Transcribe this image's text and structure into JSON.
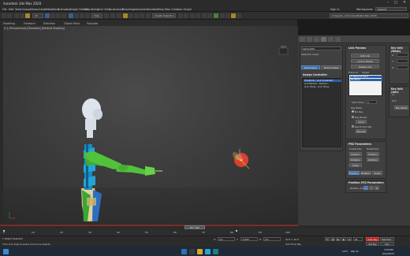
{
  "window": {
    "title": "Autodesk 3ds Max 2020",
    "workspace_label": "Workspaces:",
    "workspace_value": "Default",
    "signin": "Sign In"
  },
  "menu": [
    "File",
    "Edit",
    "Tools",
    "Group",
    "Views",
    "Create",
    "Modifiers",
    "Animation",
    "Graph Editors",
    "Rendering",
    "Civil View",
    "Customize",
    "Scripting",
    "Interactive",
    "Content",
    "Help",
    "Max Creation Graph"
  ],
  "toolbar": {
    "view_select": "View",
    "selection_set": "Create Selection Set",
    "path_field": "C:\\Users\\...\\Documents\\3ds Max 2020"
  },
  "ribbon": [
    "Modeling",
    "Freeform",
    "Selection",
    "Object Paint",
    "Populate"
  ],
  "viewport": {
    "label": "[+] [Perspective] [Standard] [Default Shading]"
  },
  "command_panel": {
    "object_name": "Sphere001",
    "selection_level_label": "Selection Level:",
    "tab_parameters": "Parameters",
    "tab_motion_paths": "Motion Paths",
    "assign_controller_title": "Assign Controller",
    "controller_list": [
      "Transform : Link Constraint",
      "Link Params : Position...",
      "Link Times : Link Times"
    ],
    "link_params_title": "Link Params",
    "add_link": "Add Link",
    "link_to_world": "Link to World",
    "delete_link": "Delete Link",
    "frame_col": "Frame #",
    "target_col": "Target",
    "link_list": [
      "0  Object-R Hand",
      "82  World"
    ],
    "start_time_label": "Start Time:",
    "start_time_value": "0",
    "key_mode_label": "Key Mode",
    "no_key": "No Key",
    "key_nodes": "Key Nodes",
    "key_entire_hierarchy": "Key Entire Hier.",
    "child": "Child",
    "parents": "Parents",
    "pos_params_title": "PRS Parameters",
    "create_key": "Create Key",
    "delete_key": "Delete Key",
    "position": "Position",
    "rotation": "Rotation",
    "scale": "Scale",
    "pos_btn": "Position",
    "rot_btn": "Rotation",
    "scale_btn": "Scale",
    "xyz_title": "Position XYZ Parameters",
    "position_axis": "Position Axis",
    "axis_x": "X",
    "axis_y": "Y",
    "axis_z": "Z",
    "key_info_basic": "Key Info (Basic)",
    "key_info_adv": "Key Info (Adv)",
    "side_x": "X:",
    "side_y": "Y:",
    "side_z": "Z:",
    "in_label": "In:",
    "out_label": "Out:",
    "normalize": "Normalize"
  },
  "timeline": {
    "slider_label": "82 / 100",
    "ticks": [
      "0",
      "10",
      "20",
      "30",
      "40",
      "50",
      "60",
      "70",
      "80",
      "90",
      "100"
    ]
  },
  "status": {
    "selected": "1 Object Selected",
    "hint": "Click and drag to select and move objects",
    "x_label": "X:",
    "x_value": "0.0",
    "y_label": "Y:",
    "y_value": "-0.461",
    "z_label": "Z:",
    "z_value": "0.0",
    "grid": "Grid = 10.0",
    "add_time_tag": "Add Time Tag",
    "auto_key": "Auto Key",
    "selected_dd": "Selected",
    "set_key": "Set Key",
    "key_filters": "Key Filters...",
    "frame": "82"
  },
  "taskbar": {
    "weather": "12°C",
    "aqi": "AQI 12",
    "time": "3:22 PM",
    "date": "6/12/2023"
  },
  "colors": {
    "accent_blue": "#3b6aa0",
    "auto_key_red": "#b81c1c",
    "torso_blue": "#2a8fc8",
    "limb_green": "#52c23a",
    "ball_red": "#d8402f"
  }
}
